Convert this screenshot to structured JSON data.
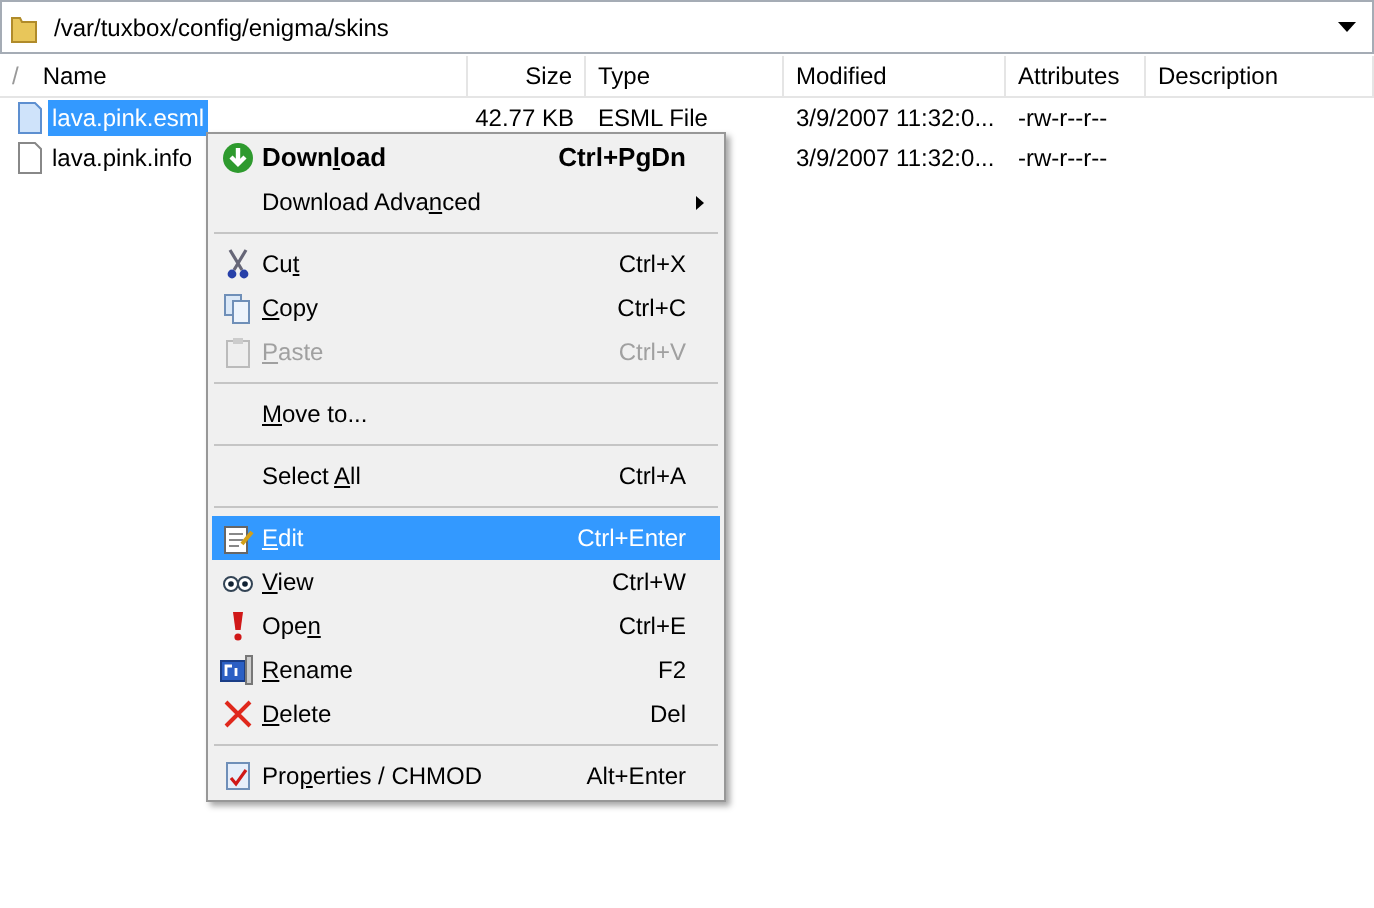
{
  "path_bar": {
    "value": "/var/tuxbox/config/enigma/skins"
  },
  "table": {
    "sort_mark": "/",
    "columns": [
      "Name",
      "Size",
      "Type",
      "Modified",
      "Attributes",
      "Description"
    ],
    "rows": [
      {
        "name": "lava.pink.esml",
        "selected": true,
        "size": "42.77 KB",
        "type": "ESML File",
        "modified": "3/9/2007 11:32:0...",
        "attributes": "-rw-r--r--"
      },
      {
        "name": "lava.pink.info",
        "selected": false,
        "modified": "3/9/2007 11:32:0...",
        "attributes": "-rw-r--r--"
      }
    ]
  },
  "context_menu": {
    "items": [
      {
        "kind": "item",
        "label": {
          "before": "Down",
          "key": "l",
          "after": "oad"
        },
        "shortcut": "Ctrl+PgDn",
        "bold": true,
        "disabled": false,
        "selected": false
      },
      {
        "kind": "item",
        "label": {
          "before": "Download Adva",
          "key": "n",
          "after": "ced"
        },
        "bold": false,
        "disabled": false,
        "selected": false,
        "submenu": true
      },
      {
        "kind": "separator"
      },
      {
        "kind": "item",
        "label": {
          "before": "Cu",
          "key": "t"
        },
        "shortcut": "Ctrl+X",
        "bold": false,
        "disabled": false,
        "selected": false
      },
      {
        "kind": "item",
        "label": {
          "key": "C",
          "after": "opy"
        },
        "shortcut": "Ctrl+C",
        "bold": false,
        "disabled": false,
        "selected": false
      },
      {
        "kind": "item",
        "label": {
          "key": "P",
          "after": "aste"
        },
        "shortcut": "Ctrl+V",
        "bold": false,
        "disabled": true,
        "selected": false
      },
      {
        "kind": "separator"
      },
      {
        "kind": "item",
        "label": {
          "key": "M",
          "after": "ove to..."
        },
        "bold": false,
        "disabled": false,
        "selected": false
      },
      {
        "kind": "separator"
      },
      {
        "kind": "item",
        "label": {
          "before": "Select ",
          "key": "A",
          "after": "ll"
        },
        "shortcut": "Ctrl+A",
        "bold": false,
        "disabled": false,
        "selected": false
      },
      {
        "kind": "separator"
      },
      {
        "kind": "item",
        "label": {
          "key": "E",
          "after": "dit"
        },
        "shortcut": "Ctrl+Enter",
        "bold": false,
        "disabled": false,
        "selected": true
      },
      {
        "kind": "item",
        "label": {
          "key": "V",
          "after": "iew"
        },
        "shortcut": "Ctrl+W",
        "bold": false,
        "disabled": false,
        "selected": false
      },
      {
        "kind": "item",
        "label": {
          "before": "Ope",
          "key": "n"
        },
        "shortcut": "Ctrl+E",
        "bold": false,
        "disabled": false,
        "selected": false
      },
      {
        "kind": "item",
        "label": {
          "key": "R",
          "after": "ename"
        },
        "shortcut": "F2",
        "bold": false,
        "disabled": false,
        "selected": false
      },
      {
        "kind": "item",
        "label": {
          "key": "D",
          "after": "elete"
        },
        "shortcut": "Del",
        "bold": false,
        "disabled": false,
        "selected": false
      },
      {
        "kind": "separator"
      },
      {
        "kind": "item",
        "label": {
          "before": "Pro",
          "key": "p",
          "after": "erties / CHMOD"
        },
        "shortcut": "Alt+Enter",
        "bold": false,
        "disabled": false,
        "selected": false
      }
    ]
  }
}
